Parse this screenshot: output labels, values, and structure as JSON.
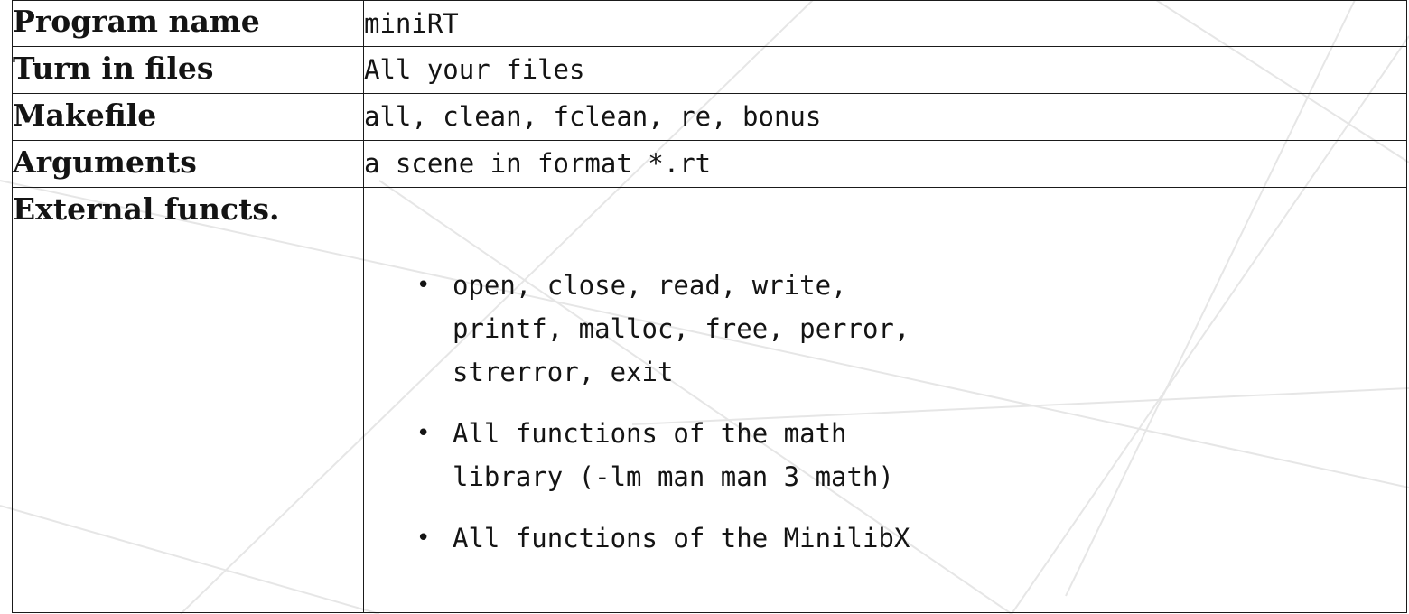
{
  "rows": [
    {
      "label": "Program name",
      "value": "miniRT"
    },
    {
      "label": "Turn in files",
      "value": "All your files"
    },
    {
      "label": "Makefile",
      "value": "all, clean, fclean, re, bonus"
    },
    {
      "label": "Arguments",
      "value": "a scene in format *.rt"
    },
    {
      "label": "External functs."
    }
  ],
  "external_functions": [
    {
      "lines": [
        "open, close, read, write,",
        "printf, malloc, free, perror,",
        "strerror, exit"
      ]
    },
    {
      "lines": [
        "All functions of the math",
        "library (-lm man man 3 math)"
      ]
    },
    {
      "lines": [
        "All functions of the MinilibX"
      ]
    }
  ],
  "bullet_glyph": "•"
}
